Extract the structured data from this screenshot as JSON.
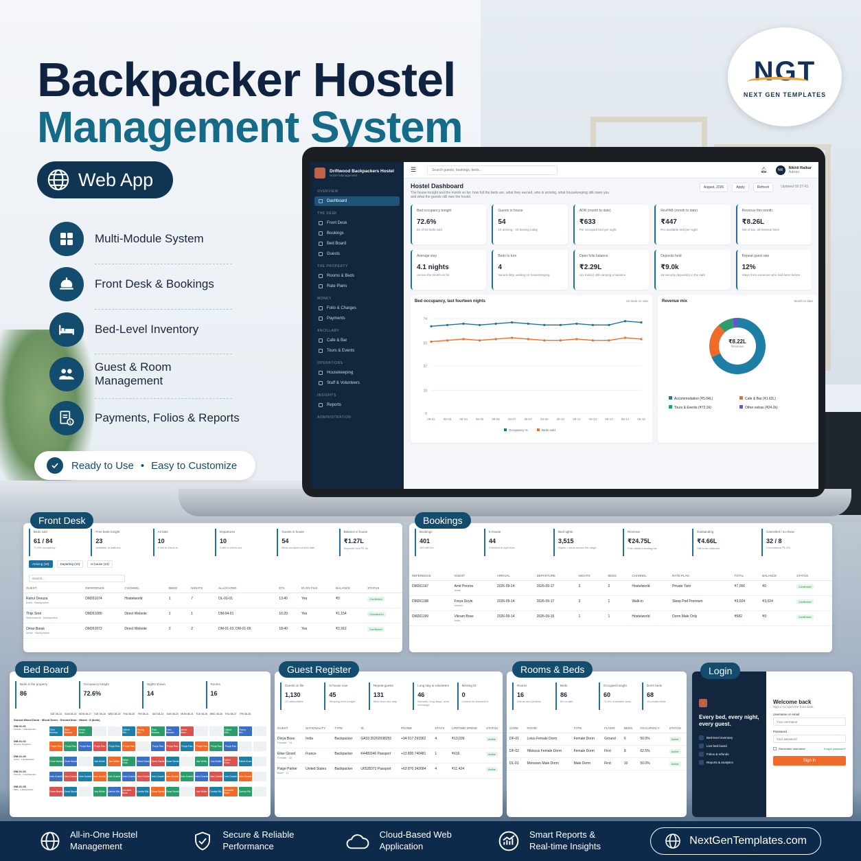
{
  "hero": {
    "title_line1": "Backpacker Hostel",
    "title_line2": "Management System",
    "badge": "Web App",
    "ready": "Ready to Use",
    "easy": "Easy to Customize",
    "bullet": "•",
    "features": [
      "Multi-Module System",
      "Front Desk & Bookings",
      "Bed-Level Inventory",
      "Guest & Room Management",
      "Payments, Folios & Reports"
    ]
  },
  "logo": {
    "mark": "NGT",
    "name": "NEXT GEN TEMPLATES"
  },
  "app": {
    "brand": "Driftwood Backpackers Hostel",
    "brand_sub": "Hostel Management",
    "search_placeholder": "Search guests, bookings, beds...",
    "user_initials": "NR",
    "user_name": "Nikhil Raikar",
    "user_role": "Admin",
    "nav": [
      {
        "sec": "OVERVIEW",
        "items": [
          "Dashboard"
        ]
      },
      {
        "sec": "THE DESK",
        "items": [
          "Front Desk",
          "Bookings",
          "Bed Board",
          "Guests"
        ]
      },
      {
        "sec": "THE PROPERTY",
        "items": [
          "Rooms & Beds",
          "Rate Plans"
        ]
      },
      {
        "sec": "MONEY",
        "items": [
          "Folio & Charges",
          "Payments"
        ]
      },
      {
        "sec": "ANCILLARY",
        "items": [
          "Cafe & Bar",
          "Tours & Events"
        ]
      },
      {
        "sec": "OPERATIONS",
        "items": [
          "Housekeeping",
          "Staff & Volunteers"
        ]
      },
      {
        "sec": "INSIGHTS",
        "items": [
          "Reports"
        ]
      },
      {
        "sec": "ADMINISTRATION",
        "items": []
      }
    ],
    "dash_title": "Hostel Dashboard",
    "dash_desc": "The house tonight and the month so far: how full the beds are, what they earned, who is arriving, what housekeeping still owes you and what the guests still owe the hostel.",
    "month": "August, 2026",
    "apply": "Apply",
    "refresh": "Refresh",
    "updated": "Updated 09:27:43",
    "kpis": [
      {
        "l": "Bed occupancy tonight",
        "v": "72.6%",
        "s": "61 of 84 beds sold"
      },
      {
        "l": "Guests in house",
        "v": "54",
        "s": "10 arriving · 10 leaving today"
      },
      {
        "l": "ADR (month to date)",
        "v": "₹633",
        "s": "Per occupied bed per night"
      },
      {
        "l": "RevPAB (month to date)",
        "v": "₹447",
        "s": "Per available bed per night"
      },
      {
        "l": "Revenue this month",
        "v": "₹8.26L",
        "s": "Net of tax, all revenue lines"
      },
      {
        "l": "Average stay",
        "v": "4.1 nights",
        "s": "Across the month so far"
      },
      {
        "l": "Beds to turn",
        "v": "4",
        "s": "Vacant dirty, waiting on housekeeping"
      },
      {
        "l": "Open folio balance",
        "v": "₹2.29L",
        "s": "111 folio(s) still carrying a balance"
      },
      {
        "l": "Deposits held",
        "v": "₹9.0k",
        "s": "18 security deposit(s) in the safe"
      },
      {
        "l": "Repeat guest rate",
        "v": "12%",
        "s": "Stays from someone who had been before"
      }
    ],
    "occ_title": "Bed occupancy, last fourteen nights",
    "occ_note": "84 beds on sale",
    "mix_title": "Revenue mix",
    "mix_note": "Month to date",
    "mix_center": "₹8.22L",
    "mix_center_sub": "Revenue",
    "mix_legend": [
      "Accommodation (₹5.64L)",
      "Cafe & Bar (₹1.62L)",
      "Tours & Events (₹72.2k)",
      "Other extras (₹24.2k)"
    ]
  },
  "chart_data": [
    {
      "type": "line",
      "title": "Bed occupancy, last fourteen nights",
      "x": [
        "08-02",
        "08-03",
        "08-04",
        "08-05",
        "08-06",
        "08-07",
        "08-07",
        "08-09",
        "08-10",
        "08-11",
        "08-12",
        "08-13",
        "08-14",
        "08-15"
      ],
      "y_ticks": [
        0,
        18,
        37,
        55,
        74
      ],
      "ylim": [
        0,
        74
      ],
      "series": [
        {
          "name": "Occupancy %",
          "color": "#1d6fa0",
          "values": [
            68,
            69,
            70,
            69,
            70,
            71,
            70,
            69,
            69,
            70,
            69,
            69,
            72,
            71
          ]
        },
        {
          "name": "Beds sold",
          "color": "#f06b2a",
          "values": [
            56,
            57,
            58,
            57,
            58,
            59,
            58,
            57,
            57,
            58,
            57,
            57,
            59,
            58
          ]
        }
      ]
    },
    {
      "type": "pie",
      "title": "Revenue mix",
      "categories": [
        "Accommodation",
        "Cafe & Bar",
        "Tours & Events",
        "Other extras"
      ],
      "values": [
        5.64,
        1.62,
        0.722,
        0.242
      ],
      "colors": [
        "#1d7fa6",
        "#f06b2a",
        "#2b9d6a",
        "#6b4fd8"
      ]
    }
  ],
  "front": {
    "title": "Front Desk",
    "kpis": [
      {
        "l": "Beds sold",
        "v": "61 / 84",
        "s": "72.6% occupancy"
      },
      {
        "l": "Free beds tonight",
        "v": "23",
        "s": "Available to walk-ins"
      },
      {
        "l": "Arrivals",
        "v": "10",
        "s": "6 still to check in"
      },
      {
        "l": "Departures",
        "v": "10",
        "s": "5 still to check out"
      },
      {
        "l": "Guests in house",
        "v": "54",
        "s": "Beds occupied on this date"
      },
      {
        "l": "Balance in house",
        "v": "₹1.27L",
        "s": "Deposits held ₹1.0k"
      }
    ],
    "tabs": [
      "Arriving (10)",
      "Departing (10)",
      "In house (44)"
    ],
    "search": "Search...",
    "cols": [
      "GUEST",
      "REFERENCE",
      "CHANNEL",
      "BEDS",
      "NIGHTS",
      "ALLOCATED",
      "ETA",
      "ID ON FILE",
      "BALANCE",
      "STATUS"
    ],
    "rows": [
      [
        "Rahul Desuza",
        "India · Backpacker",
        "DM261074",
        "Hostelworld",
        "1",
        "7",
        "DL-01-01",
        "13:40",
        "Yes",
        "₹0",
        "Confirmed"
      ],
      [
        "Thijs Smit",
        "Netherlands · Backpacker",
        "DM261080",
        "Direct Website",
        "1",
        "1",
        "DM-04-01",
        "16:20",
        "Yes",
        "₹1,154",
        "Checked In"
      ],
      [
        "Omar Barak",
        "Israel · Backpacker",
        "DM261072",
        "Direct Website",
        "2",
        "2",
        "DM-01-03, DM-01-05",
        "18:40",
        "Yes",
        "₹2,912",
        "Confirmed"
      ]
    ]
  },
  "bookings": {
    "title": "Bookings",
    "kpis": [
      {
        "l": "Bookings",
        "v": "401",
        "s": "169 still live"
      },
      {
        "l": "In house",
        "v": "44",
        "s": "Checked in right now"
      },
      {
        "l": "Bed nights",
        "v": "3,515",
        "s": "Nights × beds across the range"
      },
      {
        "l": "Revenue",
        "v": "₹24.75L",
        "s": "Folio totals including tax"
      },
      {
        "l": "Outstanding",
        "v": "₹4.66L",
        "s": "Still to be collected"
      },
      {
        "l": "Cancelled / no-show",
        "v": "32 / 8",
        "s": "Commission ₹1.20L"
      }
    ],
    "cols": [
      "REFERENCE",
      "GUEST",
      "ARRIVAL",
      "DEPARTURE",
      "NIGHTS",
      "BEDS",
      "CHANNEL",
      "RATE PLAN",
      "TOTAL",
      "BALANCE",
      "STATUS"
    ],
    "rows": [
      [
        "DM261197",
        "Amit Pereira",
        "Israel",
        "2026-09-14",
        "2026-09-17",
        "3",
        "2",
        "Hostelworld",
        "Private Twin",
        "₹7,056",
        "₹0",
        "Confirmed"
      ],
      [
        "DM261198",
        "Freya Doyle",
        "Ireland",
        "2026-09-14",
        "2026-09-17",
        "3",
        "1",
        "Walk-in",
        "Sleep Pod Premium",
        "₹3,024",
        "₹3,024",
        "Confirmed"
      ],
      [
        "DM261199",
        "Vikram Bose",
        "India",
        "2026-09-14",
        "2026-09-15",
        "1",
        "1",
        "Hostelworld",
        "Dorm Male Only",
        "₹582",
        "₹0",
        "Confirmed"
      ]
    ]
  },
  "bedboard": {
    "title": "Bed Board",
    "kpis": [
      {
        "l": "Beds in the property",
        "v": "86"
      },
      {
        "l": "Occupancy tonight",
        "v": "72.6%"
      },
      {
        "l": "Nights shown",
        "v": "14"
      },
      {
        "l": "Rooms",
        "v": "16"
      }
    ],
    "days": [
      "SAT 08-15",
      "SUN 08-16",
      "MON 08-17",
      "TUE 08-18",
      "WED 08-19",
      "THU 08-20",
      "FRI 08-21",
      "SAT 08-22",
      "SUN 08-23",
      "MON 08-24",
      "TUE 08-25",
      "WED 08-26",
      "THU 08-27",
      "FRI 08-28"
    ],
    "room": "Sunset Mixed Dorm · Mixed Dorm · Ground floor · Mixed · 8 (beds)",
    "beds": [
      {
        "id": "DM-01-01",
        "sub": "Female · 1 Backpacker",
        "cells": [
          "Theo Moreau",
          "Theo Moreau",
          "Jenna Dave...",
          "",
          "",
          "Callum Whi...",
          "Fitzroy Wri..."
        ]
      },
      {
        "id": "DM-01-02",
        "sub": "Queens Kingdom",
        "cells": [
          "Pooja Rao",
          "Pooja Rao",
          "Pooja Rao",
          "Pooja Rao",
          "Pooja Rao",
          "Pooja Rao",
          ""
        ]
      },
      {
        "id": "DM-01-03",
        "sub": "Israel · 1 Backpacker",
        "cells": [
          "Omar Barak",
          "Omar Barak",
          "",
          "Isla White",
          "Isla White",
          "Rahul Chat..",
          "Rahul Khan"
        ]
      },
      {
        "id": "DM-01-04",
        "sub": "Female · 1 Backpacker",
        "cells": [
          "Ines Duarte",
          "Ines Duarte",
          "Ines Duarte",
          "Ines Duarte",
          "Ines Duarte",
          "Ines Duarte",
          "Ines Duarte"
        ]
      },
      {
        "id": "DM-01-05",
        "sub": "Male · 1 Backpacker",
        "cells": [
          "Omar Barak",
          "Omar Barak",
          "",
          "Isla White",
          "Camila Rib..",
          "Carmela Bose",
          "Camila Rib.."
        ]
      }
    ]
  },
  "guests": {
    "title": "Guest Register",
    "kpis": [
      {
        "l": "Guests on file",
        "v": "1,130",
        "s": "22 nationalities"
      },
      {
        "l": "In house now",
        "v": "45",
        "s": "Sleeping here tonight"
      },
      {
        "l": "Repeat guests",
        "v": "131",
        "s": "More than one stay"
      },
      {
        "l": "Long stay & volunteers",
        "v": "46",
        "s": "Nomads, long stays, work exchange"
      },
      {
        "l": "Missing ID",
        "v": "0",
        "s": "Cannot be checked in"
      }
    ],
    "cols": [
      "GUEST",
      "NATIONALITY",
      "TYPE",
      "ID",
      "PHONE",
      "STAYS",
      "LIFETIME SPEND",
      "STATUS"
    ],
    "rows": [
      [
        "Divya Bose",
        "Female · 24",
        "India",
        "Backpacker",
        "GA33 20202938255",
        "+94 917 293362",
        "4",
        "₹13,039",
        "Active"
      ],
      [
        "Elise Girard",
        "Female · 32",
        "France",
        "Backpacker",
        "K4489346 Passport",
        "+13 800 740481",
        "1",
        "₹616",
        "Active"
      ],
      [
        "Paige Parker",
        "Male · 27",
        "United States",
        "Backpacker",
        "U6528371 Passport",
        "+63 870 342684",
        "4",
        "₹11,424",
        "Active"
      ]
    ]
  },
  "rooms": {
    "title": "Rooms & Beds",
    "kpis": [
      {
        "l": "Rooms",
        "v": "16",
        "s": "Dorms and privates"
      },
      {
        "l": "Beds",
        "v": "86",
        "s": "84 on sale"
      },
      {
        "l": "Occupied tonight",
        "v": "60",
        "s": "71.4% of sellable beds"
      },
      {
        "l": "Dorm beds",
        "v": "68",
        "s": "18 private beds"
      }
    ],
    "cols": [
      "CODE",
      "ROOM",
      "TYPE",
      "FLOOR",
      "BEDS",
      "OCCUPANCY",
      "STATUS"
    ],
    "rows": [
      [
        "DF-01",
        "Lotus Female Dorm",
        "Female Dorm",
        "Ground",
        "6",
        "50.0%",
        "Active"
      ],
      [
        "DF-02",
        "Hibiscus Female Dorm",
        "Female Dorm",
        "First",
        "8",
        "62.5%",
        "Active"
      ],
      [
        "DL-01",
        "Monsoon Male Dorm",
        "Male Dorm",
        "First",
        "10",
        "50.0%",
        "Active"
      ]
    ]
  },
  "login": {
    "title": "Login",
    "tagline": "Every bed, every night, every guest.",
    "perks": [
      "Bed-level inventory",
      "Live bed board",
      "Folios & refunds",
      "Reports & analytics"
    ],
    "welcome": "Welcome back",
    "welcome_sub": "Sign in to open the front desk.",
    "user_label": "Username or email",
    "user_ph": "Your username",
    "pass_label": "Password",
    "pass_ph": "Your password",
    "remember": "Remember username",
    "forgot": "Forgot password?",
    "signin": "Sign In"
  },
  "footer": {
    "items": [
      "All-in-One Hostel Management",
      "Secure & Reliable Performance",
      "Cloud-Based Web Application",
      "Smart Reports & Real-time Insights"
    ],
    "site": "NextGenTemplates.com"
  }
}
